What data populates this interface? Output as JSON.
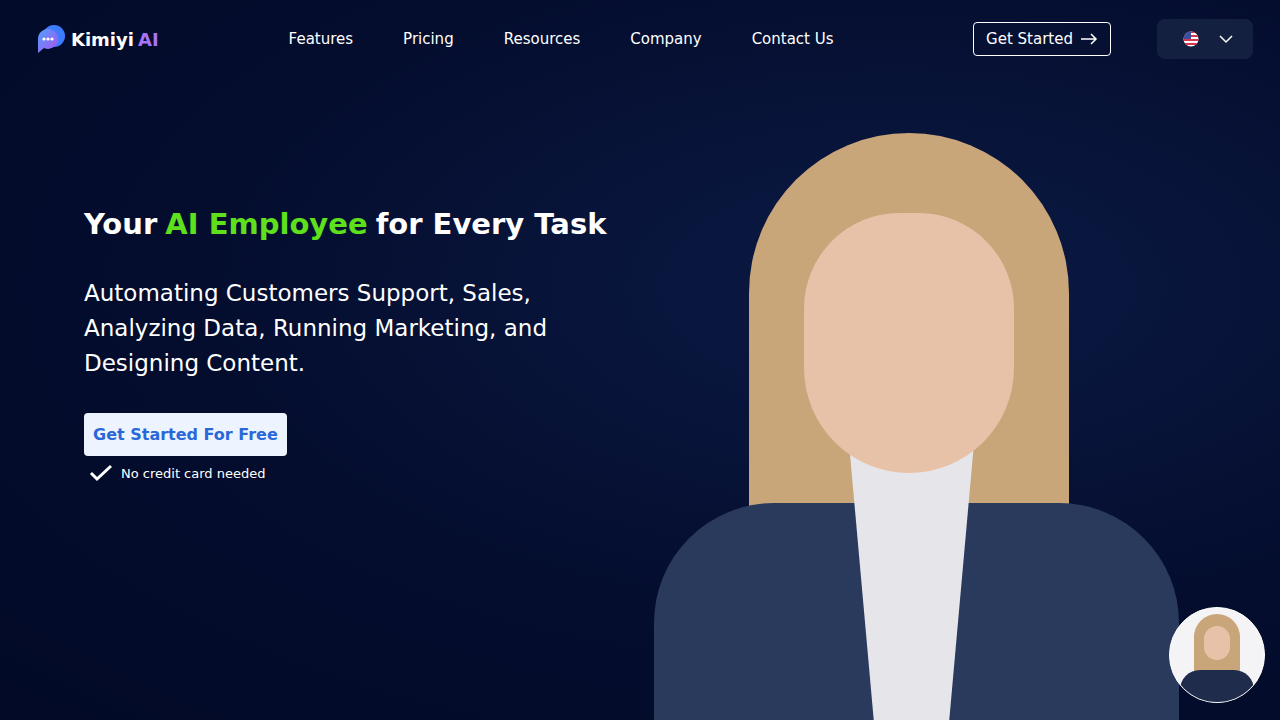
{
  "logo": {
    "name": "Kimiyi",
    "suffix": "AI"
  },
  "nav": {
    "items": [
      {
        "label": "Features"
      },
      {
        "label": "Pricing"
      },
      {
        "label": "Resources"
      },
      {
        "label": "Company"
      },
      {
        "label": "Contact Us"
      }
    ]
  },
  "header_button": {
    "label": "Get Started"
  },
  "hero": {
    "title": [
      {
        "text": "Your",
        "highlight": false
      },
      {
        "text": "AI Employee",
        "highlight": true
      },
      {
        "text": "for Every Task",
        "highlight": false
      }
    ],
    "subtitle": "Automating Customers Support, Sales, Analyzing Data, Running Marketing, and Designing Content.",
    "cta": "Get Started For Free",
    "note": "No credit card needed"
  }
}
